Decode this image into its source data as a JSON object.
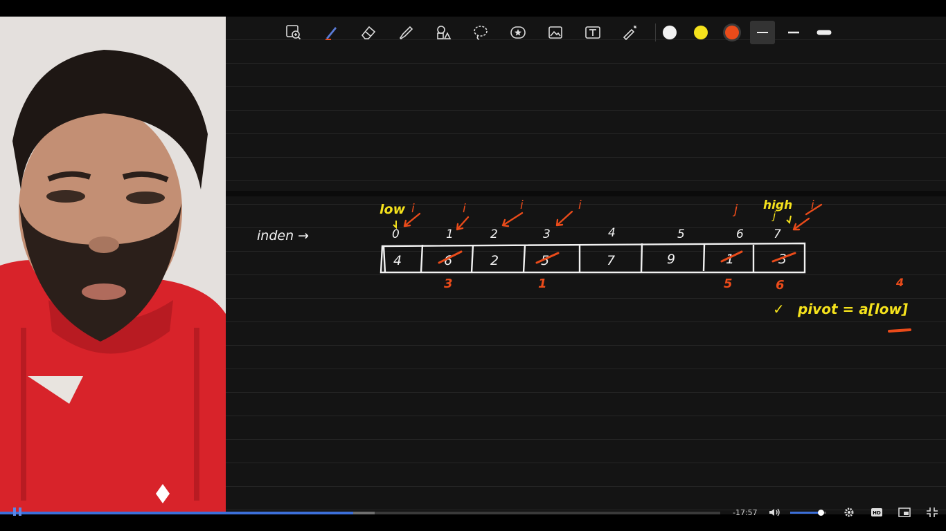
{
  "toolbar": {
    "tools": [
      {
        "name": "zoom-add-tool",
        "icon": "zoom-add-icon"
      },
      {
        "name": "pen-tool",
        "icon": "pen-icon"
      },
      {
        "name": "eraser-tool",
        "icon": "eraser-icon"
      },
      {
        "name": "highlighter-tool",
        "icon": "highlighter-icon"
      },
      {
        "name": "shapes-tool",
        "icon": "shapes-icon"
      },
      {
        "name": "lasso-tool",
        "icon": "lasso-icon"
      },
      {
        "name": "sticker-tool",
        "icon": "star-sticker-icon"
      },
      {
        "name": "image-tool",
        "icon": "image-icon"
      },
      {
        "name": "text-tool",
        "icon": "text-box-icon"
      },
      {
        "name": "laser-pointer-tool",
        "icon": "laser-pointer-icon"
      }
    ],
    "colors": {
      "white": "#f2f2f2",
      "yellow": "#f5e21c",
      "orange": "#ea4b1a",
      "selected": "orange"
    },
    "stroke_sizes": [
      "thin",
      "medium",
      "thick"
    ],
    "selected_stroke": "thin"
  },
  "board": {
    "index_label": "inden →",
    "indices": [
      "0",
      "1",
      "2",
      "3",
      "4",
      "5",
      "6",
      "7"
    ],
    "cells": [
      "4",
      "6",
      "2",
      "5",
      "7",
      "9",
      "1",
      "3"
    ],
    "struck_cells": [
      "6",
      "5",
      "1",
      "3"
    ],
    "replacement_values": [
      "3",
      "1",
      "5",
      "6"
    ],
    "pointer_labels": {
      "low": "low",
      "high": "high",
      "i": [
        "i",
        "i",
        "i",
        "i",
        "i"
      ],
      "j": [
        "j",
        "j"
      ]
    },
    "formula": {
      "check": "✓",
      "text": "pivot = a[low]",
      "annotation": "4"
    }
  },
  "player": {
    "time_remaining": "-17:57",
    "progress_played": 0.49,
    "progress_buffered": 0.52,
    "volume": 0.85,
    "controls": [
      "pause-icon",
      "volume-icon",
      "settings-gear-icon",
      "hd-quality-icon",
      "miniplayer-icon",
      "fullscreen-exit-icon"
    ]
  }
}
